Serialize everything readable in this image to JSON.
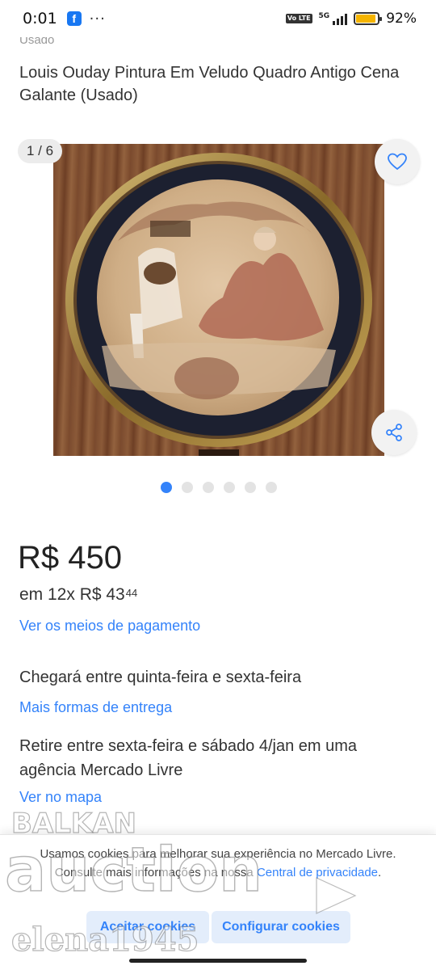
{
  "status_bar": {
    "time": "0:01",
    "app_icon": "f",
    "more": "···",
    "network": "5G",
    "volte": "Vo LTE",
    "battery_level": 0.92,
    "battery_text": "92%",
    "colors": {
      "battery": "#f5b400",
      "facebook": "#1877f2"
    }
  },
  "listing": {
    "condition": "Usado",
    "title": "Louis Ouday Pintura Em Veludo Quadro Antigo Cena Galante (Usado)"
  },
  "gallery": {
    "counter": "1 / 6",
    "image_count": 6,
    "active_index": 0,
    "favorite_icon": "heart-icon",
    "share_icon": "share-icon"
  },
  "price": {
    "main": "R$ 450",
    "installments_prefix": "em 12x R$ 43",
    "installments_cents": "44",
    "payment_link": "Ver os meios de pagamento"
  },
  "shipping": {
    "arrival": "Chegará entre quinta-feira e sexta-feira",
    "more_link": "Mais formas de entrega",
    "pickup": "Retire entre sexta-feira e sábado 4/jan em uma agência Mercado Livre",
    "map_link": "Ver no mapa"
  },
  "cookie_banner": {
    "text": "Usamos cookies para melhorar sua experiência no Mercado Livre. Consulte mais informações na nossa",
    "link": "Central de privacidade",
    "period": ".",
    "accept": "Aceitar cookies",
    "configure": "Configurar cookies"
  },
  "watermark": {
    "line1": "BALKAN",
    "line2": "auction",
    "line3": "elena1945"
  },
  "colors": {
    "accent": "#3483fa",
    "accent_bg": "#e3edfb"
  }
}
